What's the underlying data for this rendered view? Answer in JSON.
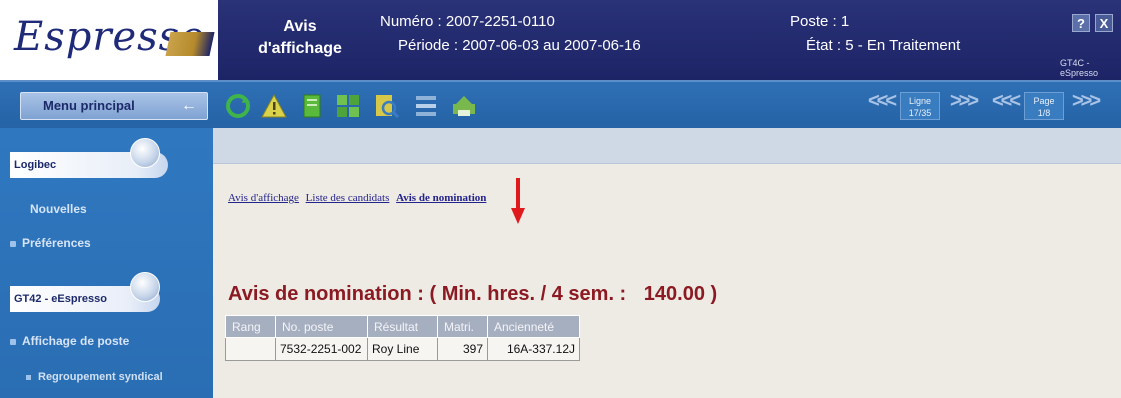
{
  "header": {
    "logo_text": "Espresso",
    "doc_title_line1": "Avis",
    "doc_title_line2": "d'affichage",
    "numero_label": "Numéro :",
    "numero_value": "2007-2251-0110",
    "periode_label": "Période :",
    "periode_value": "2007-06-03  au  2007-06-16",
    "poste_label": "Poste :",
    "poste_value": "1",
    "etat_label": "État :",
    "etat_value": "5 - En Traitement",
    "help_label": "?",
    "close_label": "X",
    "user_code": "GT4C - eSpresso"
  },
  "toolbar": {
    "menu_label": "Menu principal",
    "menu_arrow": "←",
    "ligne_label": "Ligne",
    "ligne_value": "17/35",
    "page_label": "Page",
    "page_value": "1/8",
    "nav_prev": "<<<",
    "nav_next": ">>>",
    "icon_colors": [
      "#3fb44a",
      "#d9d24a",
      "#59b93a",
      "#6fc24f",
      "#d8c84a",
      "#8fb3d8",
      "#79b84c"
    ]
  },
  "sidebar": {
    "section1": "Logibec",
    "items1": [
      "Nouvelles",
      "Préférences"
    ],
    "section2": "GT42 - eEspresso",
    "items2": [
      "Affichage de poste"
    ],
    "subitems2": [
      "Regroupement syndical"
    ]
  },
  "main": {
    "links": [
      "Avis d'affichage",
      "Liste des candidats",
      "Avis de nomination"
    ],
    "heading": "Avis de nomination :  ( Min. hres. / 4 sem. :",
    "heading_value": "140.00 )",
    "table": {
      "headers": [
        "Rang",
        "No. poste",
        "Résultat",
        "Matri.",
        "Ancienneté"
      ],
      "rows": [
        [
          "",
          "7532-2251-002",
          "Roy Line",
          "397",
          "16A-337.12J"
        ]
      ]
    }
  }
}
